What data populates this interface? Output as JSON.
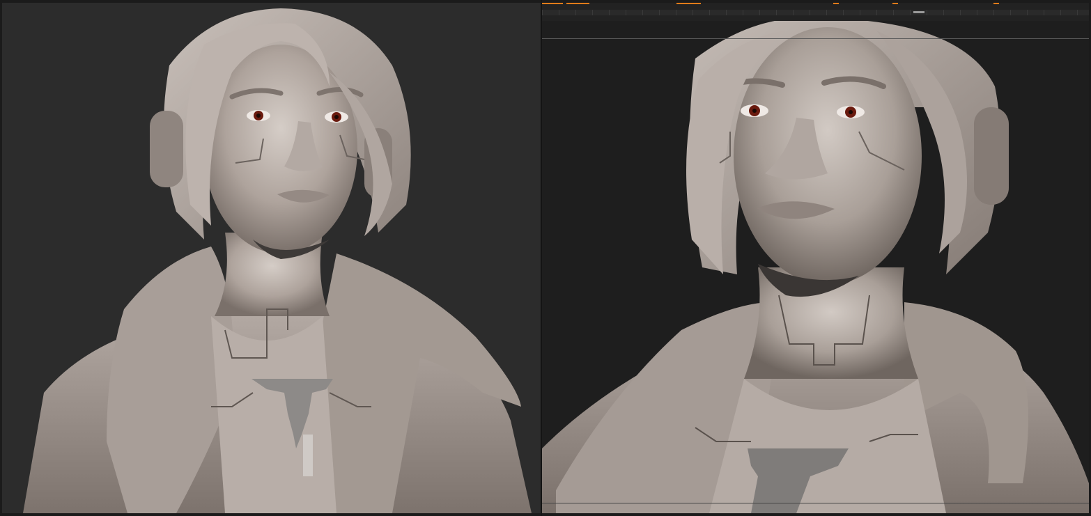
{
  "app": {
    "title": "",
    "accent": "#e07b1a"
  },
  "viewports": [
    {
      "name": "left",
      "content": "sculpt-bust-front"
    },
    {
      "name": "right",
      "content": "sculpt-bust-closeup"
    }
  ],
  "timeline": {
    "visible": true,
    "key_color": "#e07b1a"
  },
  "icons": [
    "timeline-handle-icon"
  ]
}
